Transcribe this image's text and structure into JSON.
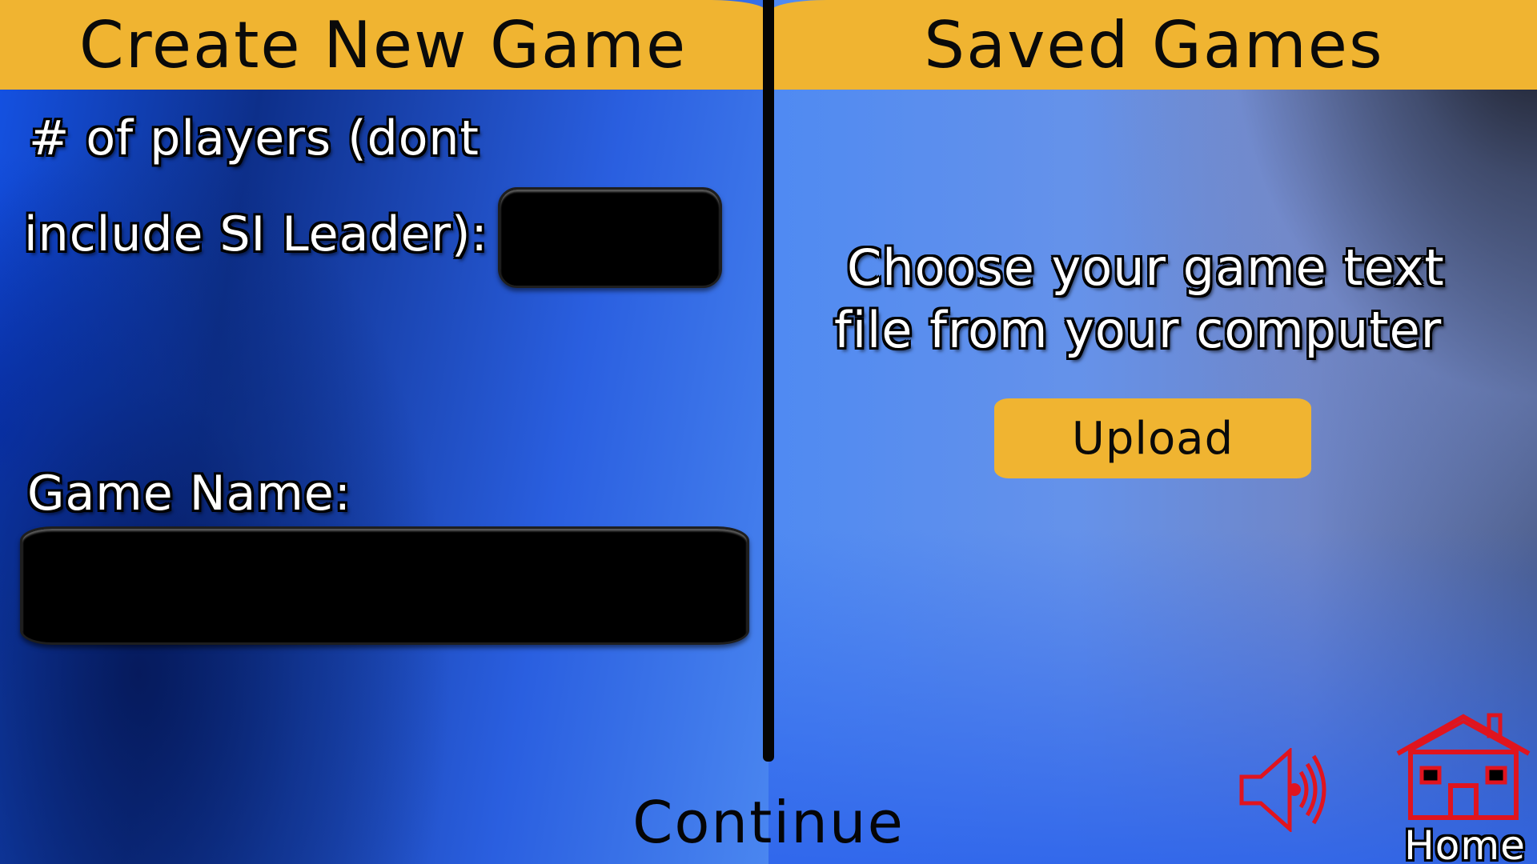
{
  "create_panel": {
    "title": "Create New Game",
    "players_label_line1": "# of players (dont",
    "players_label_line2": "include SI Leader):",
    "players_value": "",
    "game_name_label": "Game Name:",
    "game_name_value": ""
  },
  "saved_panel": {
    "title": "Saved Games",
    "instruction_line1": "Choose your game text",
    "instruction_line2": "file from your computer",
    "upload_label": "Upload"
  },
  "footer": {
    "continue_label": "Continue",
    "home_label": "Home",
    "sound_icon": "speaker-icon",
    "home_icon": "house-icon"
  },
  "colors": {
    "header_bg": "#f0b431",
    "button_bg": "#f0b431",
    "icon_red": "#e0141e",
    "input_bg": "#000000"
  }
}
